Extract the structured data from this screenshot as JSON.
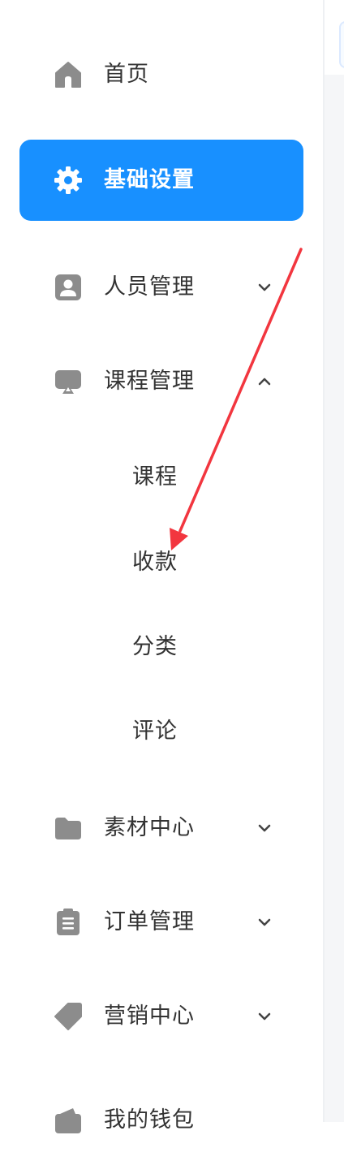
{
  "sidebar": {
    "items": [
      {
        "label": "首页",
        "icon": "home-icon"
      },
      {
        "label": "基础设置",
        "icon": "gear-icon",
        "active": true
      },
      {
        "label": "人员管理",
        "icon": "person-badge-icon",
        "expanded": false
      },
      {
        "label": "课程管理",
        "icon": "presentation-icon",
        "expanded": true
      },
      {
        "label": "素材中心",
        "icon": "folder-icon",
        "expanded": false
      },
      {
        "label": "订单管理",
        "icon": "clipboard-icon",
        "expanded": false
      },
      {
        "label": "营销中心",
        "icon": "tag-icon",
        "expanded": false
      },
      {
        "label": "我的钱包",
        "icon": "wallet-icon"
      }
    ],
    "course_submenu": [
      {
        "label": "课程"
      },
      {
        "label": "收款"
      },
      {
        "label": "分类"
      },
      {
        "label": "评论"
      }
    ]
  },
  "colors": {
    "active_bg": "#1890ff",
    "icon_gray": "#8c8c8c",
    "text": "#333333",
    "annotation_arrow": "#f2363f"
  }
}
